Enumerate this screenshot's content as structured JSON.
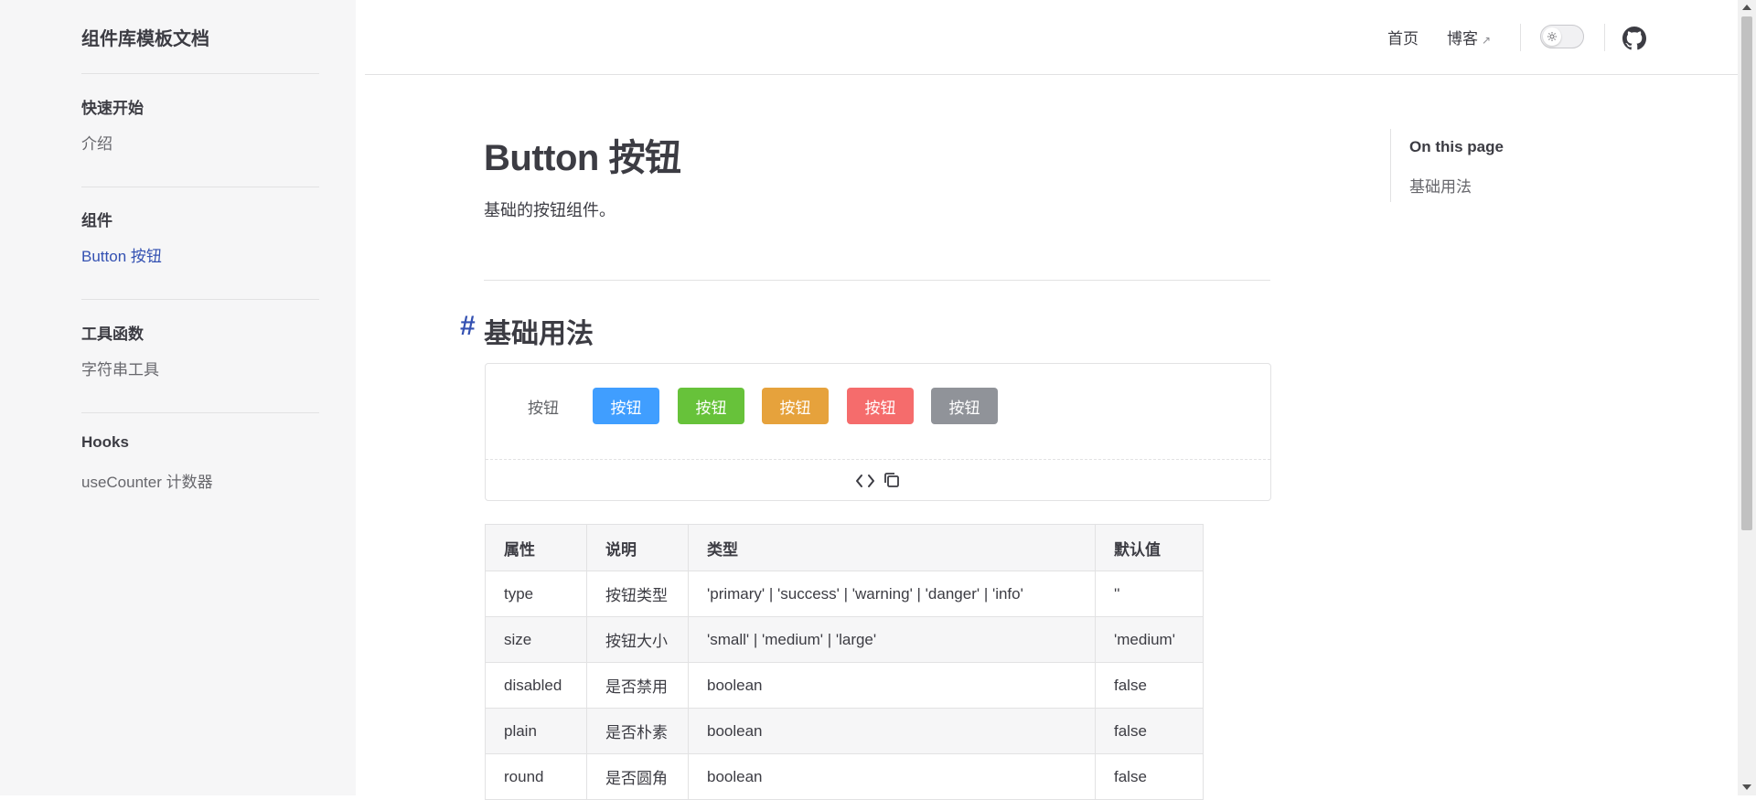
{
  "sidebar": {
    "title": "组件库模板文档",
    "groups": [
      {
        "title": "快速开始",
        "items": [
          {
            "label": "介绍",
            "active": false
          }
        ]
      },
      {
        "title": "组件",
        "items": [
          {
            "label": "Button 按钮",
            "active": true
          }
        ]
      },
      {
        "title": "工具函数",
        "items": [
          {
            "label": "字符串工具",
            "active": false
          }
        ]
      },
      {
        "title": "Hooks",
        "items": [
          {
            "label": "useCounter 计数器",
            "active": false
          }
        ]
      }
    ]
  },
  "nav": {
    "home_label": "首页",
    "blog_label": "博客",
    "blog_external_icon": "↗",
    "theme_icon": "sun-icon",
    "github_icon": "github-icon"
  },
  "page": {
    "title": "Button 按钮",
    "description": "基础的按钮组件。",
    "anchor": "#",
    "section_title": "基础用法"
  },
  "demo": {
    "buttons": [
      {
        "label": "按钮",
        "type": "default",
        "color": "#ffffff"
      },
      {
        "label": "按钮",
        "type": "primary",
        "color": "#409eff"
      },
      {
        "label": "按钮",
        "type": "success",
        "color": "#67c23a"
      },
      {
        "label": "按钮",
        "type": "warning",
        "color": "#e6a23c"
      },
      {
        "label": "按钮",
        "type": "danger",
        "color": "#f56c6c"
      },
      {
        "label": "按钮",
        "type": "info",
        "color": "#909399"
      }
    ],
    "code_icon": "code-icon",
    "copy_icon": "copy-icon"
  },
  "props_table": {
    "headers": [
      "属性",
      "说明",
      "类型",
      "默认值"
    ],
    "rows": [
      [
        "type",
        "按钮类型",
        "'primary' | 'success' | 'warning' | 'danger' | 'info'",
        "''"
      ],
      [
        "size",
        "按钮大小",
        "'small' | 'medium' | 'large'",
        "'medium'"
      ],
      [
        "disabled",
        "是否禁用",
        "boolean",
        "false"
      ],
      [
        "plain",
        "是否朴素",
        "boolean",
        "false"
      ],
      [
        "round",
        "是否圆角",
        "boolean",
        "false"
      ]
    ]
  },
  "outline": {
    "title": "On this page",
    "items": [
      "基础用法"
    ]
  },
  "colors": {
    "brand": "#3451b2",
    "sidebar_bg": "#f6f6f7",
    "divider": "#e2e2e3"
  }
}
